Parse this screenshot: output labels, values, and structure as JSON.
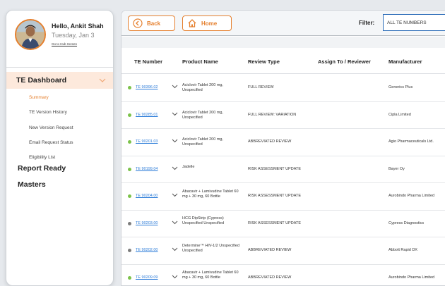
{
  "sidebar": {
    "greeting": "Hello, Ankit Shah",
    "date": "Tuesday, Jan 3",
    "hub_link": "Go to Hub Screen",
    "dashboard_title": "TE Dashboard",
    "items": [
      {
        "label": "Summary",
        "active": true
      },
      {
        "label": "TE Version History",
        "active": false
      },
      {
        "label": "New Version Request",
        "active": false
      },
      {
        "label": "Email Request Status",
        "active": false
      },
      {
        "label": "Eligibility List",
        "active": false
      }
    ],
    "sections": [
      "Report Ready",
      "Masters"
    ],
    "accent_color": "#e57f2d"
  },
  "toolbar": {
    "back_label": "Back",
    "home_label": "Home",
    "filter_label": "Filter:",
    "filter_value": "ALL TE NUMBERS"
  },
  "table": {
    "columns": [
      "TE Number",
      "Product Name",
      "Review Type",
      "Assign To / Reviewer",
      "Manufacturer"
    ],
    "rows": [
      {
        "te": "TE 90396.02",
        "status": "green",
        "product": "Aciclovir Tablet 200 mg, Unspecified",
        "review": "FULL REVIEW",
        "assign": "",
        "manufacturer": "Generics Plus"
      },
      {
        "te": "TE 90285.01",
        "status": "green",
        "product": "Aciclovir Tablet 200 mg, Unspecified",
        "review": "FULL REVIEW: VARIATION",
        "assign": "",
        "manufacturer": "Cipla Limited"
      },
      {
        "te": "TE 90201.03",
        "status": "green",
        "product": "Aciclovir Tablet 200 mg, Unspecified",
        "review": "ABBREVIATED REVIEW",
        "assign": "",
        "manufacturer": "Agio Pharmaceuticals Ltd."
      },
      {
        "te": "TE 90199.04",
        "status": "green",
        "product": "Jadelle",
        "review": "RISK ASSESSMENT UPDATE",
        "assign": "",
        "manufacturer": "Bayer Oy"
      },
      {
        "te": "TE 90204.00",
        "status": "green",
        "product": "Abacavir + Lamivudine Tablet 60 mg + 30 mg, 60 Bottle",
        "review": "RISK ASSESSMENT UPDATE",
        "assign": "",
        "manufacturer": "Aurobindo Pharma Limited"
      },
      {
        "te": "TE 90203.00",
        "status": "gray",
        "product": "HCG DipStrip (Cypress) Unspecified Unspecified",
        "review": "RISK ASSESSMENT UPDATE",
        "assign": "",
        "manufacturer": "Cypress Diagnostics"
      },
      {
        "te": "TE 90202.00",
        "status": "gray",
        "product": "Determine™ HIV-1/2 Unspecified Unspecified",
        "review": "ABBREVIATED REVIEW",
        "assign": "",
        "manufacturer": "Abbott Rapid DX"
      },
      {
        "te": "TE 90209.09",
        "status": "green",
        "product": "Abacavir + Lamivudine Tablet 60 mg + 30 mg, 60 Bottle",
        "review": "ABBREVIATED REVIEW",
        "assign": "",
        "manufacturer": "Aurobindo Pharma Limited"
      }
    ],
    "status_colors": {
      "green": "#7cc24a",
      "gray": "#7d7d7d"
    }
  }
}
